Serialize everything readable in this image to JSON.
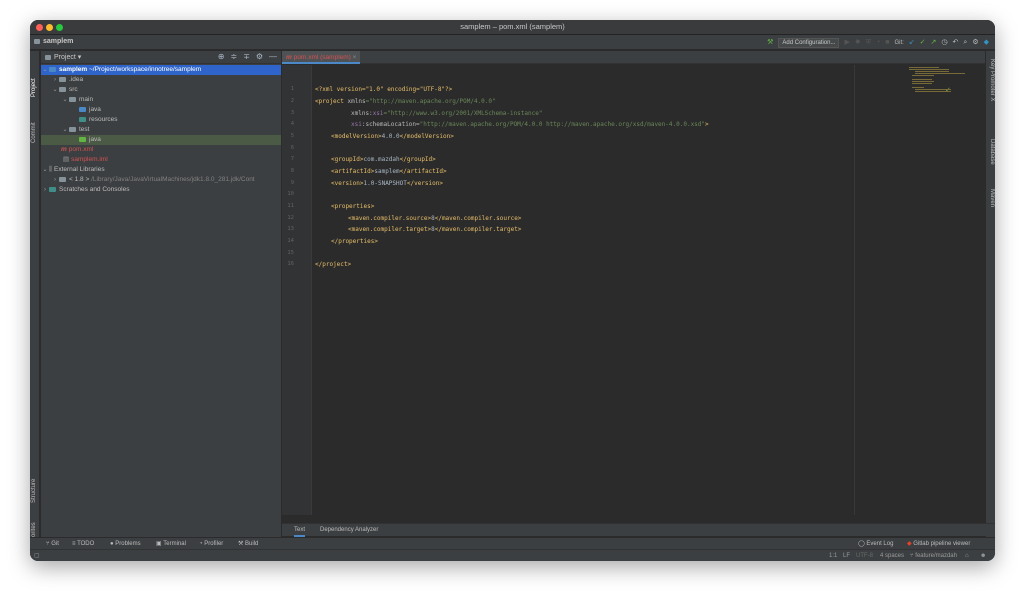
{
  "window": {
    "title": "samplem – pom.xml (samplem)"
  },
  "navbar": {
    "breadcrumb": "samplem",
    "run_config_label": "Add Configuration...",
    "git_label": "Git:"
  },
  "side_left": {
    "project_label": "Project",
    "commit_label": "Commit",
    "structure_label": "Structure",
    "favorites_label": "Favorites"
  },
  "side_right": {
    "promoter_label": "Key Promoter X",
    "database_label": "Database",
    "maven_label": "Maven"
  },
  "project_panel": {
    "title": "Project",
    "tree": [
      {
        "label": "samplem",
        "suffix": "~/Project/workspace/innotree/samplem",
        "expanded": true
      },
      {
        "label": ".idea"
      },
      {
        "label": "src"
      },
      {
        "label": "main"
      },
      {
        "label": "java"
      },
      {
        "label": "resources"
      },
      {
        "label": "test"
      },
      {
        "label": "java"
      },
      {
        "label": "pom.xml"
      },
      {
        "label": "samplem.iml"
      },
      {
        "label": "External Libraries"
      },
      {
        "label": "< 1.8 >",
        "suffix": "/Library/Java/JavaVirtualMachines/jdk1.8.0_281.jdk/Cont"
      },
      {
        "label": "Scratches and Consoles"
      }
    ]
  },
  "editor": {
    "tab_label": "pom.xml (samplem)",
    "line_numbers": [
      "1",
      "2",
      "3",
      "4",
      "5",
      "6",
      "7",
      "8",
      "9",
      "10",
      "11",
      "12",
      "13",
      "14",
      "15",
      "16"
    ],
    "lines": [
      [
        "<?xml version=\"1.0\" encoding=\"UTF-8\"?>"
      ],
      [
        "<project ",
        "xmlns",
        "=\"http://maven.apache.org/POM/4.0.0\""
      ],
      [
        "xmlns:",
        "xsi",
        "=\"http://www.w3.org/2001/XMLSchema-instance\""
      ],
      [
        "xsi",
        ":schemaLocation=",
        "\"http://maven.apache.org/POM/4.0.0 http://maven.apache.org/xsd/maven-4.0.0.xsd\"",
        ">"
      ],
      [
        "<modelVersion>",
        "4.0.0",
        "</modelVersion>"
      ],
      [
        ""
      ],
      [
        "<groupId>",
        "com.mazdah",
        "</groupId>"
      ],
      [
        "<artifactId>",
        "samplem",
        "</artifactId>"
      ],
      [
        "<version>",
        "1.0-SNAPSHOT",
        "</version>"
      ],
      [
        ""
      ],
      [
        "<properties>"
      ],
      [
        "<maven.compiler.source>",
        "8",
        "</maven.compiler.source>"
      ],
      [
        "<maven.compiler.target>",
        "8",
        "</maven.compiler.target>"
      ],
      [
        "</properties>"
      ],
      [
        ""
      ],
      [
        "</project>"
      ]
    ]
  },
  "bottom_tabs": [
    "Text",
    "Dependency Analyzer"
  ],
  "toolwindows": {
    "git": "Git",
    "todo": "TODO",
    "problems": "Problems",
    "terminal": "Terminal",
    "profiler": "Profiler",
    "build": "Build",
    "event_log": "Event Log",
    "gitlab": "Gitlab pipeline viewer"
  },
  "status": {
    "position": "1:1",
    "line_sep": "LF",
    "encoding": "UTF-8",
    "indent": "4 spaces",
    "branch": "feature/mazdah"
  },
  "colors": {
    "selection": "#2f65ca",
    "tag": "#e8bf6a",
    "string": "#6a8759"
  }
}
